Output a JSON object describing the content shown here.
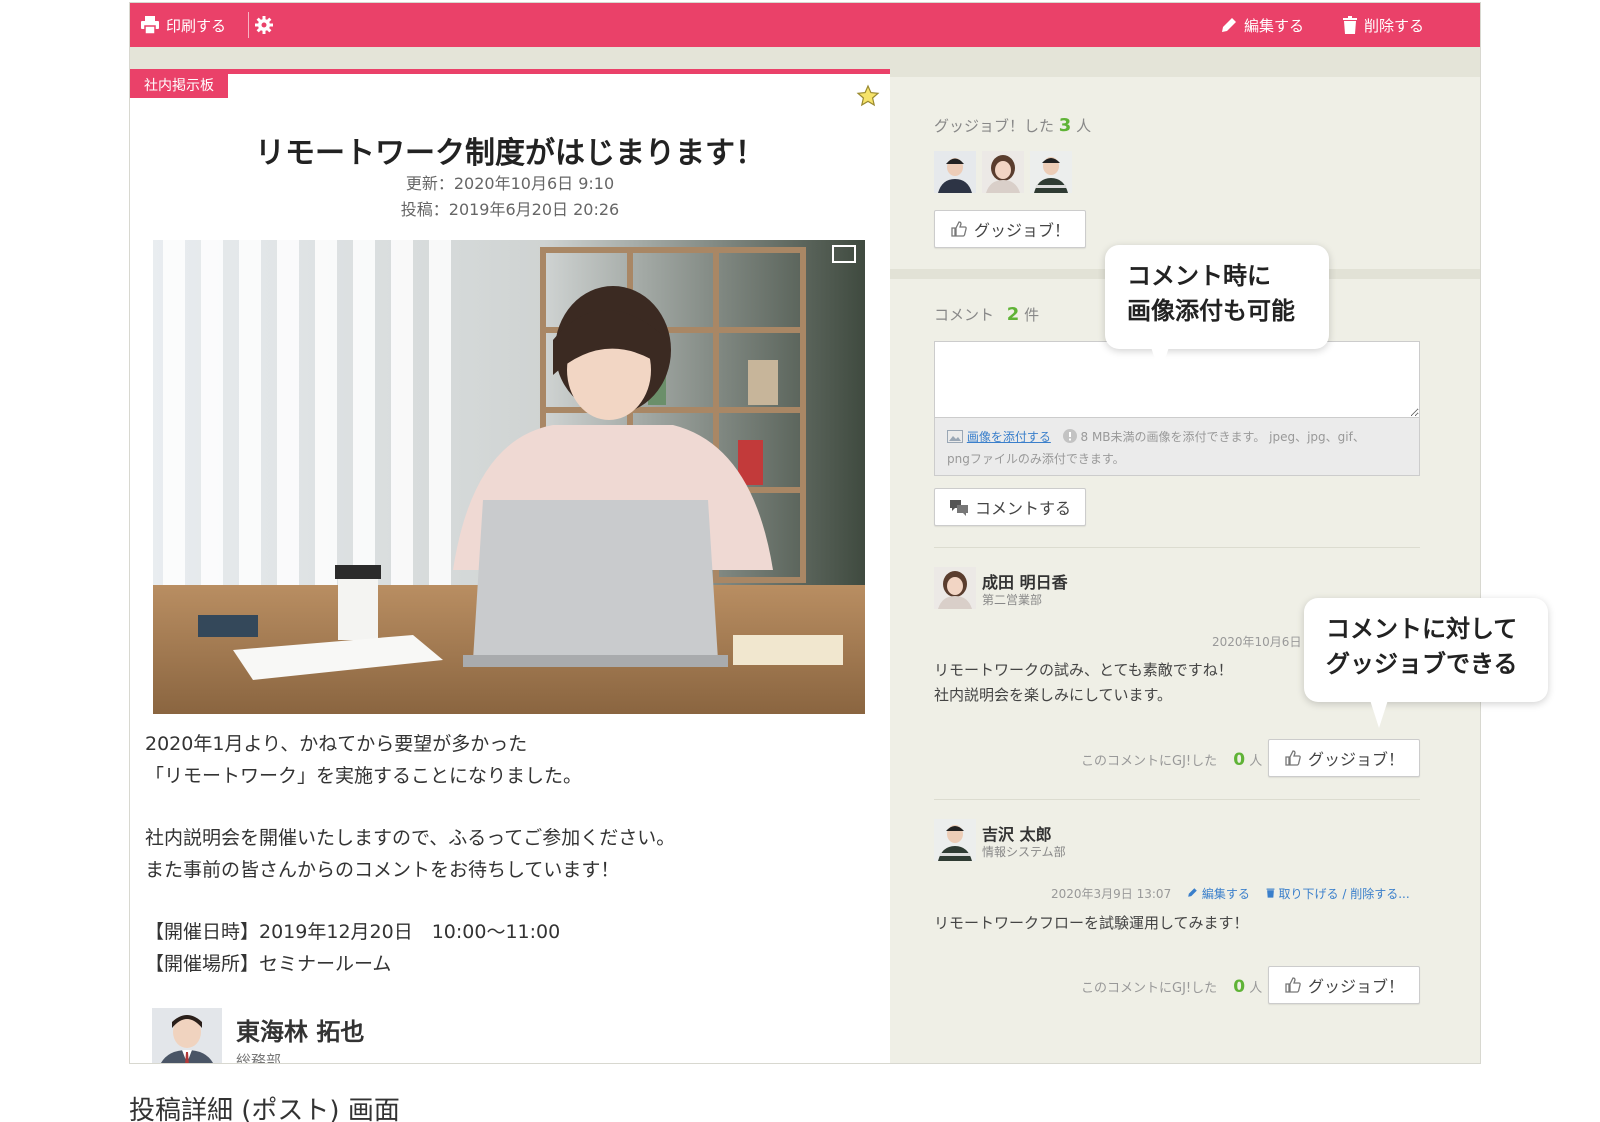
{
  "toolbar": {
    "print_label": "印刷する",
    "settings_icon": "gear-icon",
    "edit_label": "編集する",
    "delete_label": "削除する"
  },
  "post": {
    "category": "社内掲示板",
    "title": "リモートワーク制度がはじまります！",
    "updated": "更新：2020年10月6日 9:10",
    "posted": "投稿：2019年6月20日 20:26",
    "body": {
      "p1_line1": "2020年1月より、かねてから要望が多かった",
      "p1_line2": "「リモートワーク」を実施することになりました。",
      "p2_line1": "社内説明会を開催いたしますので、ふるってご参加ください。",
      "p2_line2": "また事前の皆さんからのコメントをお待ちしています！",
      "p3_line1": "【開催日時】2019年12月20日　10:00～11:00",
      "p3_line2": "【開催場所】セミナールーム"
    },
    "author": {
      "name": "東海林 拓也",
      "department": "総務部"
    }
  },
  "goodjob": {
    "label": "グッジョブ！した",
    "count": "3",
    "unit": "人",
    "button_label": "グッジョブ！"
  },
  "comments": {
    "label": "コメント",
    "count": "2",
    "unit": "件",
    "textarea_value": "",
    "attach_link": "画像を添付する",
    "attach_note_line1": "8 MB未満の画像を添付できます。 jpeg、jpg、gif、",
    "attach_note_line2": "pngファイルのみ添付できます。",
    "submit_label": "コメントする",
    "items": [
      {
        "name": "成田 明日香",
        "department": "第二営業部",
        "date": "2020年10月6日",
        "text_line1": "リモートワークの試み、とても素敵ですね！",
        "text_line2": "社内説明会を楽しみにしています。",
        "gj_label": "このコメントにGJ!した",
        "gj_count": "0",
        "gj_unit": "人",
        "gj_button": "グッジョブ！"
      },
      {
        "name": "吉沢 太郎",
        "department": "情報システム部",
        "date": "2020年3月9日 13:07",
        "edit_link": "編集する",
        "remove_link": "取り下げる / 削除する...",
        "text_line1": "リモートワークフローを試験運用してみます！",
        "gj_label": "このコメントにGJ!した",
        "gj_count": "0",
        "gj_unit": "人",
        "gj_button": "グッジョブ！"
      }
    ]
  },
  "callouts": {
    "image_attach_line1": "コメント時に",
    "image_attach_line2": "画像添付も可能",
    "goodjob_line1": "コメントに対して",
    "goodjob_line2": "グッジョブできる"
  },
  "caption": "投稿詳細 (ポスト) 画面",
  "colors": {
    "accent": "#ea4169",
    "count_green": "#5fb336",
    "link_blue": "#3a7fcb"
  }
}
